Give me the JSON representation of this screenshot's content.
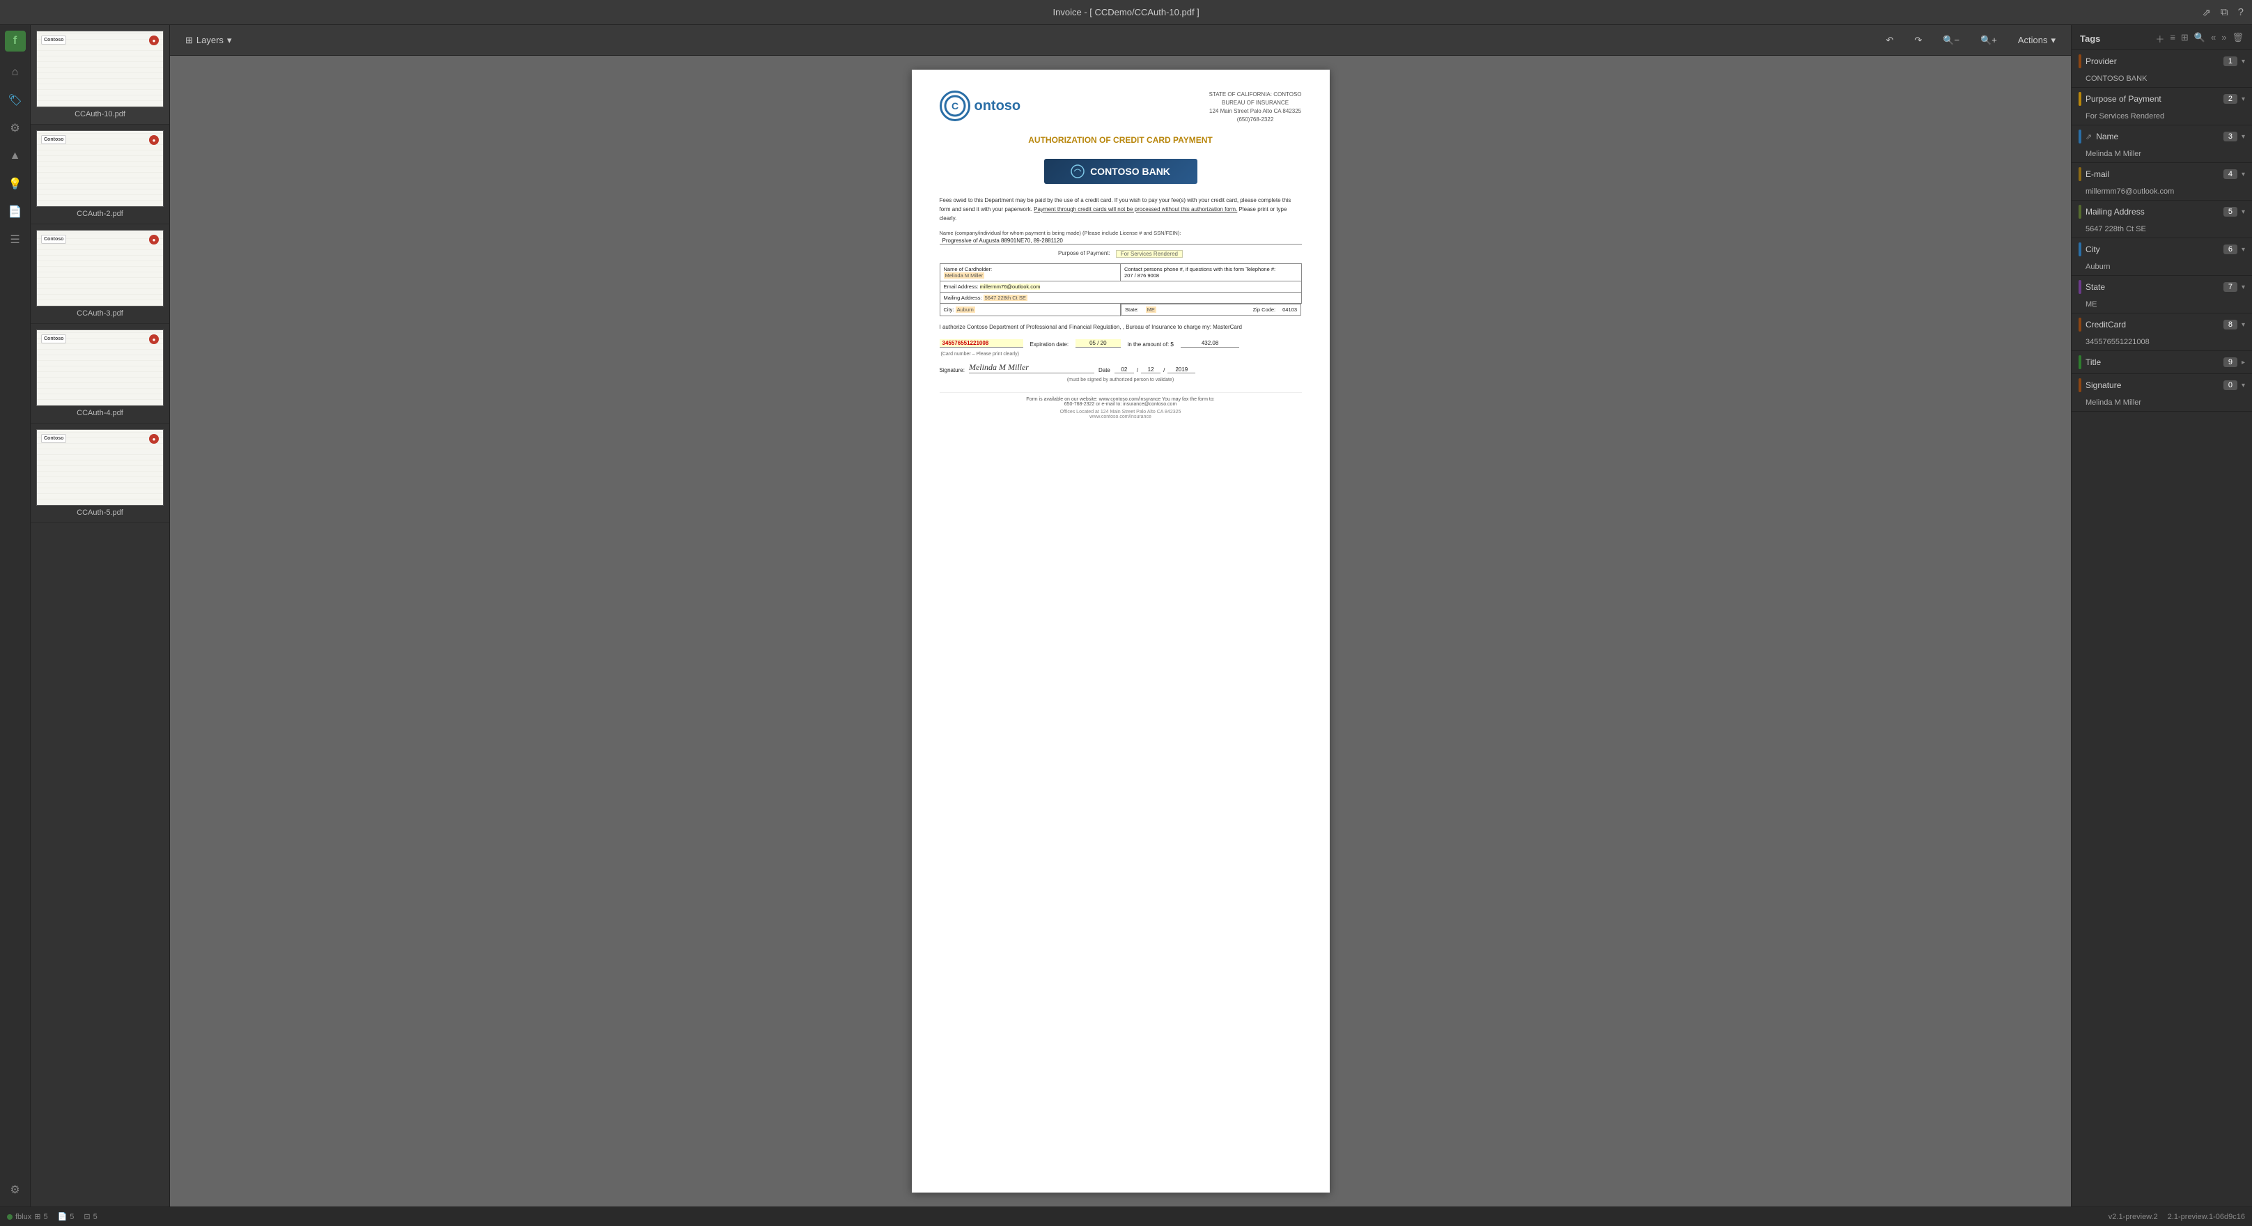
{
  "app": {
    "title": "Invoice - [ CCDemo/CCAuth-10.pdf ]",
    "version": "v2.1-preview.2",
    "build": "2.1-preview.1-06d9c16"
  },
  "topbar": {
    "title": "Invoice - [ CCDemo/CCAuth-10.pdf ]",
    "icons": [
      "share",
      "window",
      "help"
    ]
  },
  "toolbar": {
    "layers_label": "Layers",
    "actions_label": "Actions"
  },
  "thumbnails": [
    {
      "label": "CCAuth-10.pdf",
      "active": true,
      "badge": true
    },
    {
      "label": "CCAuth-2.pdf",
      "active": false,
      "badge": true
    },
    {
      "label": "CCAuth-3.pdf",
      "active": false,
      "badge": true
    },
    {
      "label": "CCAuth-4.pdf",
      "active": false,
      "badge": true
    },
    {
      "label": "CCAuth-5.pdf",
      "active": false,
      "badge": true
    }
  ],
  "document": {
    "logo_letter": "C",
    "logo_text": "ontoso",
    "state_line1": "STATE OF CALIFORNIA: CONTOSO",
    "state_line2": "BUREAU OF INSURANCE",
    "state_line3": "124 Main Street Palo Alto CA 842325",
    "state_line4": "(650)768-2322",
    "title": "AUTHORIZATION OF CREDIT CARD PAYMENT",
    "bank_name": "CONTOSO BANK",
    "body_text1": "Fees owed to this Department may be paid by the use of a credit card.  If you wish to pay your fee(s) with your credit card, please complete this form and send it with your paperwork.",
    "body_text2": "Payment through credit cards will not be processed without this authorization form.",
    "body_text3": "Please print or type clearly.",
    "name_label": "Name (company/individual for whom payment is being made) (Please include License # and SSN/FEIN):",
    "name_value": "Progressive of Augusta  88901NE70,  89-2881120",
    "purpose_label": "Purpose of Payment:",
    "purpose_value": "For Services Rendered",
    "cardholder_label": "Name of Cardholder:",
    "cardholder_value": "Melinda M Miller",
    "email_label": "Email Address:",
    "email_value": "millermm76@outlook.com",
    "contact_label": "Contact persons phone #, if questions with this form  Telephone #:",
    "contact_area_code": "207",
    "contact_prefix": "876",
    "contact_number": "9008",
    "mailing_label": "Mailing Address:",
    "mailing_value": "5647 228th Ct SE",
    "city_label": "City:",
    "city_value": "Auburn",
    "state_label": "State:",
    "state_value": "ME",
    "zip_label": "Zip Code:",
    "zip_value": "04103",
    "auth_text": "I authorize Contoso Department of Professional and Financial Regulation, , Bureau of Insurance to charge my:   MasterCard",
    "card_label": "(Card number – Please print clearly)",
    "card_number": "345576551221008",
    "expiry_label": "Expiration date:",
    "expiry_month": "05",
    "expiry_year": "20",
    "amount_label": "in the amount of: $",
    "amount_value": "432.08",
    "sig_label": "Signature:",
    "sig_value": "Melinda M Miller",
    "date_label": "Date",
    "date_month": "02",
    "date_day": "12",
    "date_year": "2019",
    "must_sign": "(must be signed by authorized person to validate)",
    "footer_web": "Form is available on our website:  www.contoso.com/insurance  You may fax the form to:",
    "footer_fax": "650-768-2322 or e-mail to:  insurance@contoso.com",
    "offices": "Offices Located at 124 Main Street Palo Alto CA 842325",
    "offices2": "www.contoso.com/insurance"
  },
  "tags": {
    "title": "Tags",
    "items": [
      {
        "name": "Provider",
        "count": "1",
        "color": "#8B4513",
        "value": "CONTOSO BANK",
        "expanded": true
      },
      {
        "name": "Purpose of Payment",
        "count": "2",
        "color": "#b8860b",
        "value": "For Services Rendered",
        "expanded": true
      },
      {
        "name": "Name",
        "count": "3",
        "color": "#2a6ea6",
        "value": "Melinda M Miller",
        "expanded": true,
        "has_link": true
      },
      {
        "name": "E-mail",
        "count": "4",
        "color": "#8B6914",
        "value": "millermm76@outlook.com",
        "expanded": true
      },
      {
        "name": "Mailing Address",
        "count": "5",
        "color": "#556B2F",
        "value": "5647 228th Ct SE",
        "expanded": true
      },
      {
        "name": "City",
        "count": "6",
        "color": "#2a6ea6",
        "value": "Auburn",
        "expanded": true
      },
      {
        "name": "State",
        "count": "7",
        "color": "#6B3A8A",
        "value": "ME",
        "expanded": true
      },
      {
        "name": "CreditCard",
        "count": "8",
        "color": "#8B4513",
        "value": "345576551221008",
        "expanded": true
      },
      {
        "name": "Title",
        "count": "9",
        "color": "#2e7d2e",
        "value": "",
        "expanded": false
      },
      {
        "name": "Signature",
        "count": "0",
        "color": "#8B4513",
        "value": "Melinda M Miller",
        "expanded": true
      }
    ]
  },
  "statusbar": {
    "app": "fblux",
    "app_count": "5",
    "pages_icon": "pages",
    "pages_count": "5",
    "layers_count": "5",
    "version": "v2.1-preview.2",
    "build": "2.1-preview.1-06d9c16"
  }
}
